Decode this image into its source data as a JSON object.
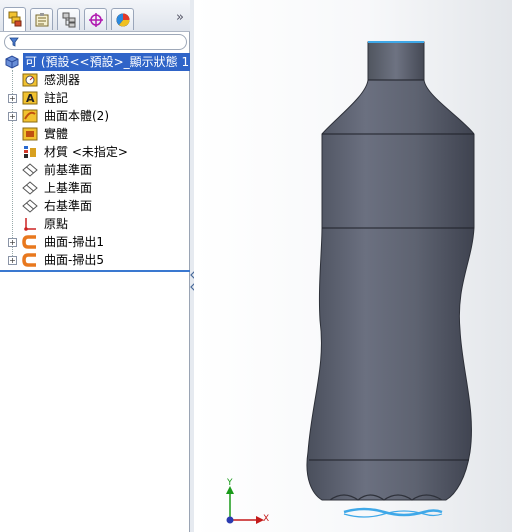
{
  "tabs": [
    {
      "name": "featuremanager-tab",
      "icon": "featuremanager-icon"
    },
    {
      "name": "propertymanager-tab",
      "icon": "propertymanager-icon"
    },
    {
      "name": "configurationmanager-tab",
      "icon": "configurationmanager-icon"
    },
    {
      "name": "dimxpert-tab",
      "icon": "dimxpert-icon"
    },
    {
      "name": "display-manager-tab",
      "icon": "display-manager-icon"
    }
  ],
  "tab_more_label": "»",
  "tree": {
    "root_label": "可 (預設<<預設>_顯示狀態 1",
    "items": [
      {
        "label": "感測器",
        "icon": "sensor-icon",
        "expandable": false
      },
      {
        "label": "註記",
        "icon": "annotation-icon",
        "expandable": true
      },
      {
        "label": "曲面本體(2)",
        "icon": "surface-bodies-icon",
        "expandable": true
      },
      {
        "label": "實體",
        "icon": "solid-bodies-icon",
        "expandable": false
      },
      {
        "label": "材質 <未指定>",
        "icon": "material-icon",
        "expandable": false
      },
      {
        "label": "前基準面",
        "icon": "plane-icon",
        "expandable": false
      },
      {
        "label": "上基準面",
        "icon": "plane-icon",
        "expandable": false
      },
      {
        "label": "右基準面",
        "icon": "plane-icon",
        "expandable": false
      },
      {
        "label": "原點",
        "icon": "origin-icon",
        "expandable": false
      },
      {
        "label": "曲面-掃出1",
        "icon": "surface-sweep-icon",
        "expandable": true
      },
      {
        "label": "曲面-掃出5",
        "icon": "surface-sweep-icon",
        "expandable": true
      }
    ]
  },
  "triad": {
    "x_label": "X",
    "y_label": "Y"
  },
  "colors": {
    "selection": "#2f64c8",
    "model_body": "#5e6371",
    "rollback_bar": "#3a78d0",
    "feature_yellow": "#f2c230",
    "sweep_orange": "#e8781e"
  }
}
